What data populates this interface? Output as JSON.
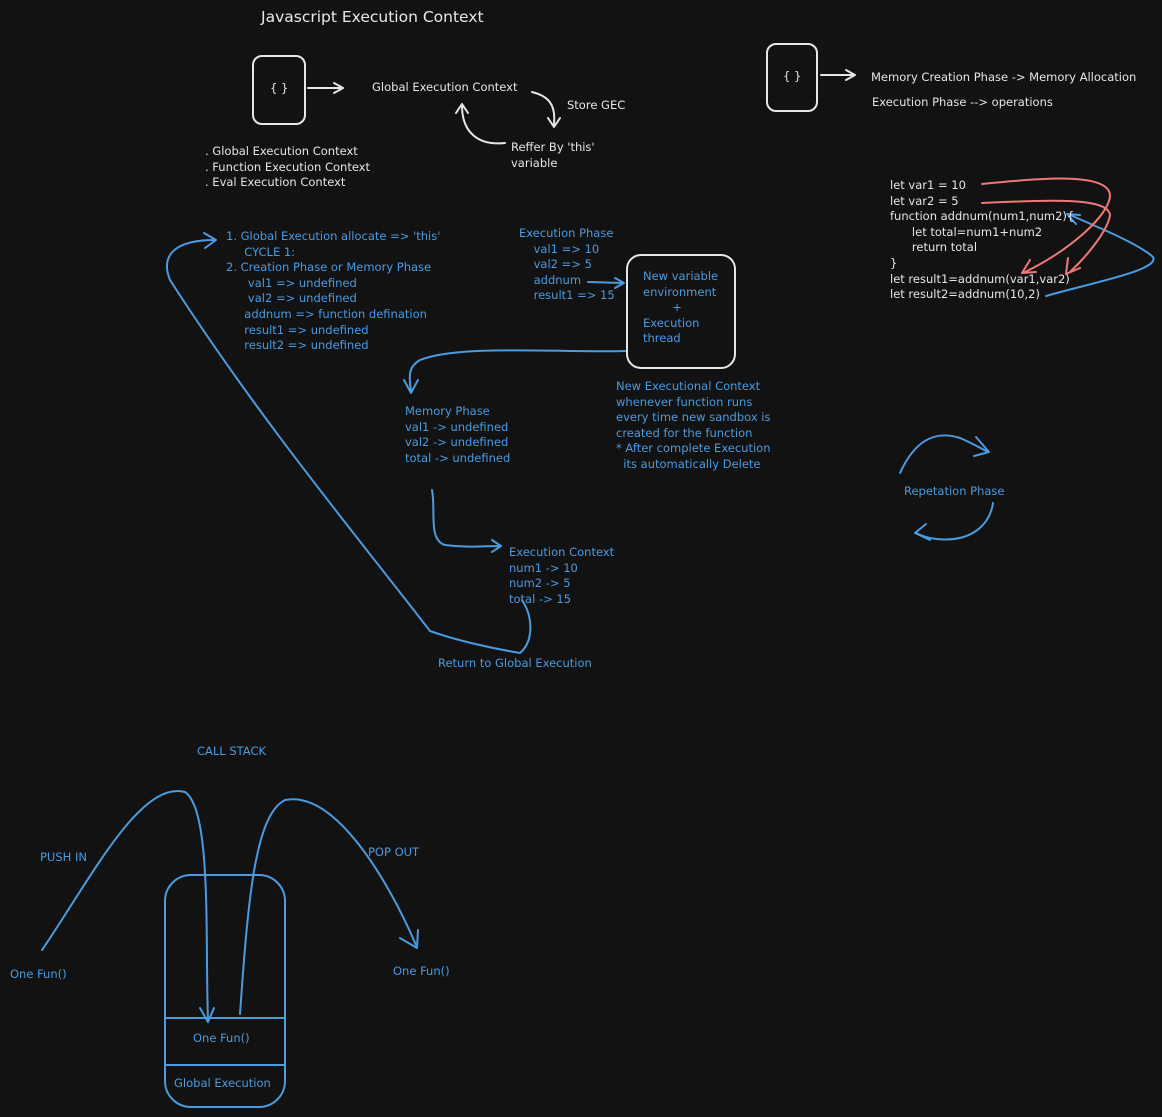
{
  "title": "Javascript Execution Context",
  "colors": {
    "background": "#121212",
    "white": "#e6e6e6",
    "blue": "#4a9be0",
    "red": "#f07878"
  },
  "gec": {
    "box_icon": "{ }",
    "label": "Global Execution Context",
    "store": "Store GEC",
    "reffer": "Reffer By 'this'\nvariable",
    "types": ". Global Execution Context\n. Function Execution Context\n. Eval Execution Context"
  },
  "phases": {
    "box_icon": "{ }",
    "memory": "Memory Creation Phase -> Memory Allocation",
    "execution": "Execution Phase --> operations"
  },
  "code": "let var1 = 10\nlet var2 = 5\nfunction addnum(num1,num2){\n      let total=num1+num2\n      return total\n}\nlet result1=addnum(var1,var2)\nlet result2=addnum(10,2)",
  "cycle": "1. Global Execution allocate => 'this'\n     CYCLE 1:\n2. Creation Phase or Memory Phase\n      val1 => undefined\n      val2 => undefined\n     addnum => function defination\n     result1 => undefined\n     result2 => undefined",
  "exec_phase": "Execution Phase\n    val1 => 10\n    val2 => 5\n    addnum\n    result1 => 15",
  "new_env": "New variable\nenvironment\n        +\nExecution\nthread",
  "new_context": "New Executional Context\nwhenever function runs\nevery time new sandbox is\ncreated for the function\n* After complete Execution\n  its automatically Delete",
  "memory_phase": "Memory Phase\nval1 -> undefined\nval2 -> undefined\ntotal -> undefined",
  "exec_context": "Execution Context\nnum1 -> 10\nnum2 -> 5\ntotal -> 15",
  "return_label": "Return to Global Execution",
  "repetition": "Repetation Phase",
  "call_stack": {
    "title": "CALL STACK",
    "push": "PUSH IN",
    "pop": "POP OUT",
    "fun_left": "One Fun()",
    "fun_right": "One Fun()",
    "slot_top": "One Fun()",
    "slot_bottom": "Global Execution"
  }
}
